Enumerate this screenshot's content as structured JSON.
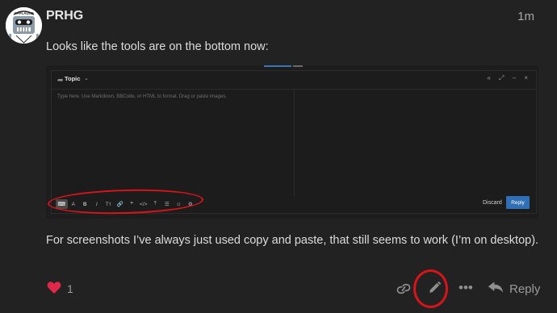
{
  "post": {
    "username": "PRHG",
    "time": "1m",
    "paragraph1": "Looks like the tools are on the bottom now:",
    "paragraph2": "For screenshots I’ve always just used copy and paste, that still seems to work (I’m on desktop).",
    "avatar_label": "APPLAUSE"
  },
  "composer": {
    "topic_label": "Topic",
    "caret": "⌄",
    "window_controls": "« ⤢ – ×",
    "placeholder": "Type here. Use Markdown, BBCode, or HTML to format. Drag or paste images.",
    "toolbar": [
      "⌨",
      "A",
      "B",
      "I",
      "Tᴛ",
      "🔗",
      "❞",
      "</>",
      "⤒",
      "☰",
      "☺",
      "⚙"
    ],
    "discard_label": "Discard",
    "reply_label": "Reply"
  },
  "actions": {
    "like_count": "1",
    "more": "•••",
    "reply_label": "Reply"
  },
  "colors": {
    "background": "#222222",
    "heart": "#e0284a",
    "annotation_red": "#d8141a",
    "primary_blue": "#2f6fb6"
  }
}
